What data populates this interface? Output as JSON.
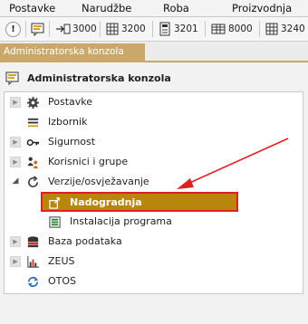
{
  "menu": [
    "Postavke",
    "Narudžbe",
    "Roba",
    "Proizvodnja"
  ],
  "toolbar": {
    "items": [
      "3000",
      "3200",
      "3201",
      "8000",
      "3240"
    ]
  },
  "tab": {
    "label": "Administratorska konzola"
  },
  "panel": {
    "title": "Administratorska konzola"
  },
  "tree": [
    {
      "label": "Postavke",
      "icon": "gear-icon"
    },
    {
      "label": "Izbornik",
      "icon": "menu-list-icon"
    },
    {
      "label": "Sigurnost",
      "icon": "key-icon"
    },
    {
      "label": "Korisnici i grupe",
      "icon": "users-icon"
    },
    {
      "label": "Verzije/osvježavanje",
      "icon": "refresh-icon",
      "expanded": true
    },
    {
      "label": "Nadogradnja",
      "icon": "upgrade-icon",
      "selected": true,
      "child": true
    },
    {
      "label": "Instalacija programa",
      "icon": "install-icon",
      "child": true
    },
    {
      "label": "Baza podataka",
      "icon": "database-icon"
    },
    {
      "label": "ZEUS",
      "icon": "chart-icon"
    },
    {
      "label": "OTOS",
      "icon": "sync-icon"
    }
  ]
}
